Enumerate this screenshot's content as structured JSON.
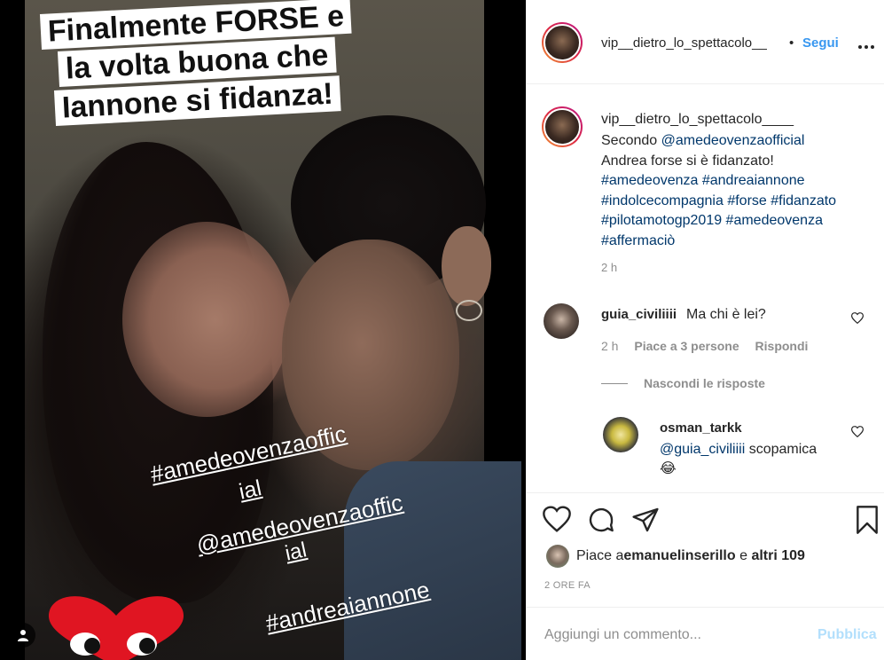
{
  "story": {
    "caption_lines": [
      "Finalmente FORSE e",
      "la volta buona che",
      "Iannone si fidanza!"
    ],
    "tags": [
      "#amedeovenzaoffic",
      "ial",
      "@amedeovenzaoffic",
      "ial",
      "#andreaiannone"
    ]
  },
  "header": {
    "username": "vip__dietro_lo_spettacolo__",
    "separator": "•",
    "follow_label": "Segui",
    "more_label": "..."
  },
  "caption": {
    "username": "vip__dietro_lo_spettacolo____",
    "text_prefix": "Secondo ",
    "mention": "@amedeovenzaofficial",
    "line2": "Andrea forse si è fidanzato!",
    "hashtags": "#amedeovenza #andreaiannone #indolcecompagnia #forse #fidanzato #pilotamotogp2019 #amedeovenza #affermaciò",
    "time": "2 h"
  },
  "comments": [
    {
      "username": "guia_civiliiii",
      "text": "Ma chi è lei?",
      "time": "2 h",
      "likes": "Piace a 3 persone",
      "reply_label": "Rispondi"
    }
  ],
  "hide_replies_label": "Nascondi le risposte",
  "reply": {
    "username": "osman_tarkk",
    "mention": "@guia_civiliiii",
    "text": " scopamica",
    "emoji": "😂"
  },
  "likes": {
    "prefix": "Piace a ",
    "user": "emanuelinserillo",
    "middle": " e ",
    "others": "altri 109"
  },
  "post_time": "2 ORE FA",
  "composer": {
    "placeholder": "Aggiungi un commento...",
    "publish_label": "Pubblica"
  },
  "colors": {
    "link": "#00376b",
    "follow": "#3897f0",
    "muted": "#8e8e8e",
    "publish_disabled": "#b2dffc"
  }
}
